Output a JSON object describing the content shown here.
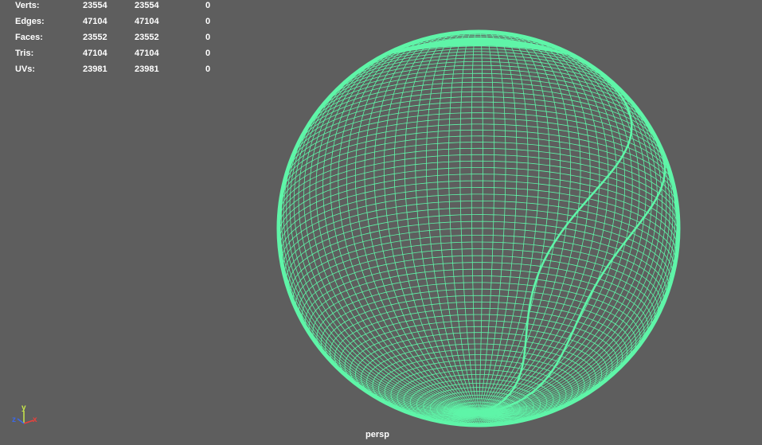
{
  "hud": {
    "rows": [
      {
        "label": "Verts:",
        "v1": "23554",
        "v2": "23554",
        "v3": "0"
      },
      {
        "label": "Edges:",
        "v1": "47104",
        "v2": "47104",
        "v3": "0"
      },
      {
        "label": "Faces:",
        "v1": "23552",
        "v2": "23552",
        "v3": "0"
      },
      {
        "label": "Tris:",
        "v1": "47104",
        "v2": "47104",
        "v3": "0"
      },
      {
        "label": "UVs:",
        "v1": "23981",
        "v2": "23981",
        "v3": "0"
      }
    ]
  },
  "viewport": {
    "camera": "persp",
    "background_color": "#5e5e5e",
    "wireframe_color": "#5ff5a8"
  },
  "axis": {
    "x": "x",
    "y": "y",
    "z": "z",
    "x_color": "#e8413c",
    "y_color": "#c8e84a",
    "z_color": "#3c68e8"
  }
}
